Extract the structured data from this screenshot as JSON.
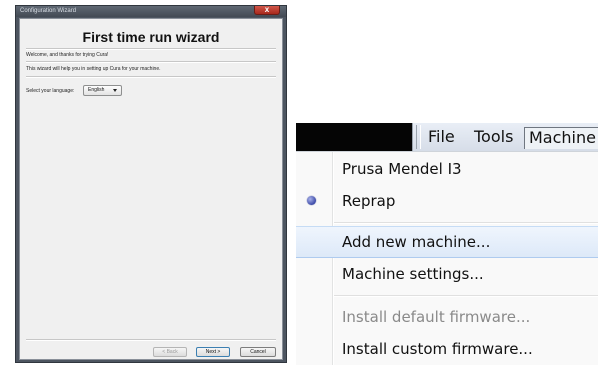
{
  "wizard": {
    "window_title": "Configuration Wizard",
    "close_label": "x",
    "heading": "First time run wizard",
    "welcome_text": "Welcome, and thanks for trying Cura!",
    "info_text": "This wizard will help you in setting up Cura for your machine.",
    "language_label": "Select your language:",
    "language_value": "English",
    "buttons": {
      "back": "< Back",
      "next": "Next >",
      "cancel": "Cancel"
    }
  },
  "menubar": {
    "items": [
      "File",
      "Tools",
      "Machine"
    ]
  },
  "machine_menu": {
    "items": [
      {
        "label": "Prusa Mendel I3",
        "selected": false,
        "enabled": true
      },
      {
        "label": "Reprap",
        "selected": true,
        "enabled": true
      },
      {
        "label": "Add new machine...",
        "hovered": true,
        "enabled": true
      },
      {
        "label": "Machine settings...",
        "enabled": true
      },
      {
        "label": "Install default firmware...",
        "enabled": false
      },
      {
        "label": "Install custom firmware...",
        "enabled": true
      }
    ]
  },
  "colors": {
    "window_frame": "#4d5560",
    "dialog_bg": "#f0f0f0",
    "menu_bg": "#f9f9f9",
    "hover_bg": "#dde9f8",
    "radio": "#3c4aa8",
    "disabled_text": "#8a8a8a"
  }
}
